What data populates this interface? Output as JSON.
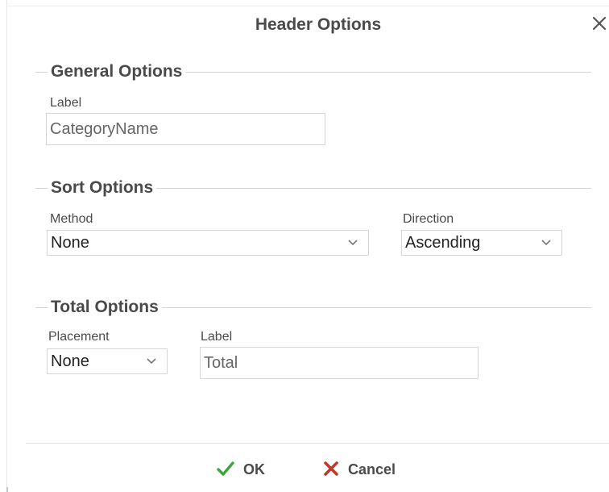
{
  "dialog": {
    "title": "Header Options",
    "close_icon": "close-icon"
  },
  "general": {
    "legend": "General Options",
    "label_caption": "Label",
    "label_value": "CategoryName"
  },
  "sort": {
    "legend": "Sort Options",
    "method_caption": "Method",
    "method_value": "None",
    "direction_caption": "Direction",
    "direction_value": "Ascending"
  },
  "total": {
    "legend": "Total Options",
    "placement_caption": "Placement",
    "placement_value": "None",
    "label_caption": "Label",
    "label_value": "Total"
  },
  "footer": {
    "ok_label": "OK",
    "ok_icon": "check-icon",
    "ok_color": "#3aa73a",
    "cancel_label": "Cancel",
    "cancel_icon": "x-icon",
    "cancel_color": "#c0392b"
  }
}
